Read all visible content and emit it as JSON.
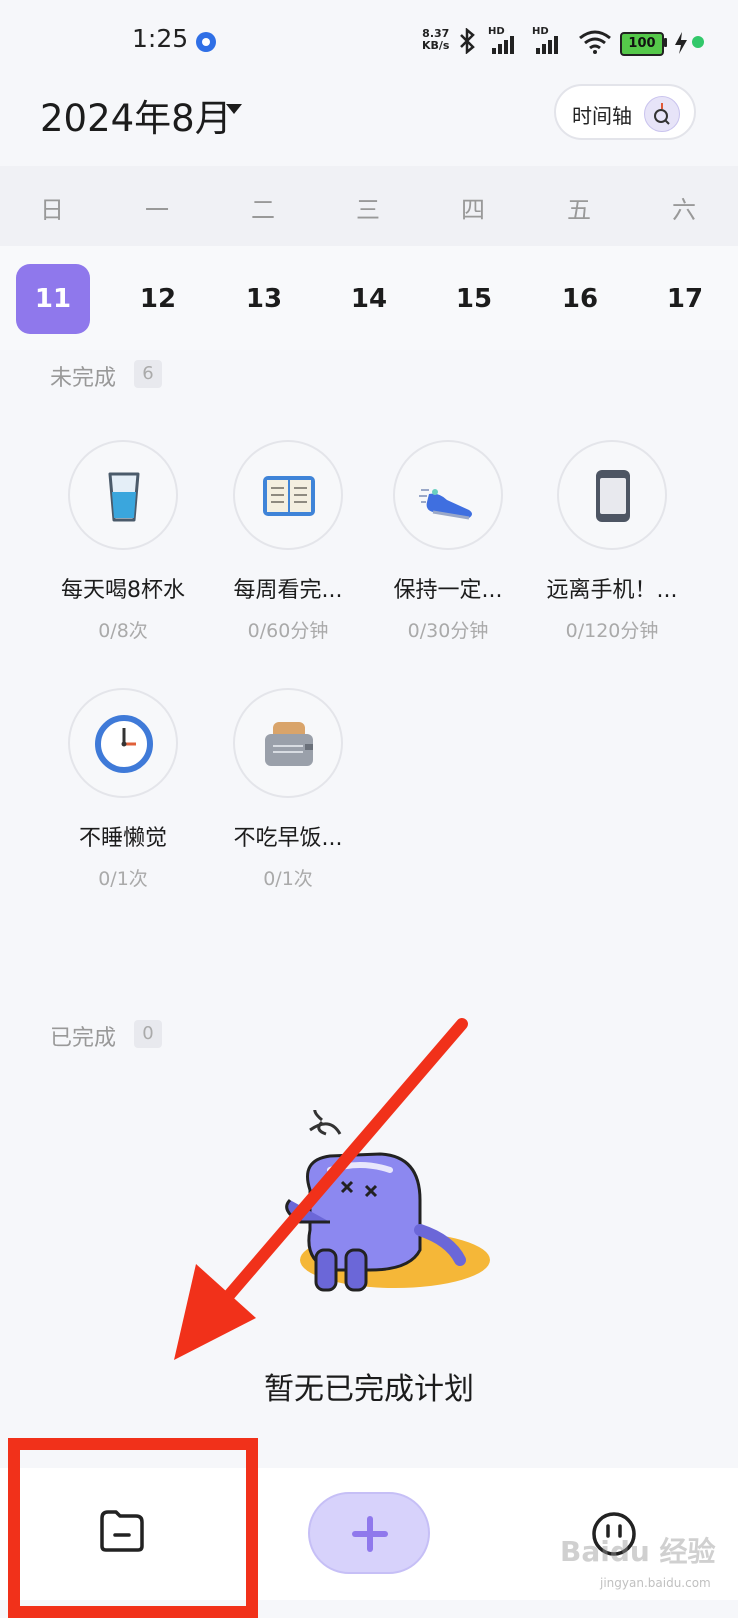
{
  "status_bar": {
    "time": "1:25",
    "speed_value": "8.37",
    "speed_unit": "KB/s",
    "signal_label_1": "HD",
    "signal_label_2": "HD",
    "battery": "100"
  },
  "header": {
    "month_title": "2024年8月",
    "timeline_label": "时间轴"
  },
  "week": {
    "weekdays": [
      "日",
      "一",
      "二",
      "三",
      "四",
      "五",
      "六"
    ],
    "dates": [
      "11",
      "12",
      "13",
      "14",
      "15",
      "16",
      "17"
    ],
    "selected_index": 0
  },
  "incomplete": {
    "label": "未完成",
    "count": "6",
    "habits": [
      {
        "name": "每天喝8杯水",
        "progress": "0/8次",
        "icon": "water-glass-icon"
      },
      {
        "name": "每周看完...",
        "progress": "0/60分钟",
        "icon": "book-icon"
      },
      {
        "name": "保持一定...",
        "progress": "0/30分钟",
        "icon": "sneaker-icon"
      },
      {
        "name": "远离手机！...",
        "progress": "0/120分钟",
        "icon": "phone-icon"
      },
      {
        "name": "不睡懒觉",
        "progress": "0/1次",
        "icon": "clock-icon"
      },
      {
        "name": "不吃早饭...",
        "progress": "0/1次",
        "icon": "toaster-icon"
      }
    ]
  },
  "completed": {
    "label": "已完成",
    "count": "0",
    "empty_text": "暂无已完成计划"
  },
  "colors": {
    "accent": "#8f78ec",
    "annotation": "#f1311a"
  },
  "watermark": {
    "main": "Baidu 经验",
    "sub": "jingyan.baidu.com"
  }
}
